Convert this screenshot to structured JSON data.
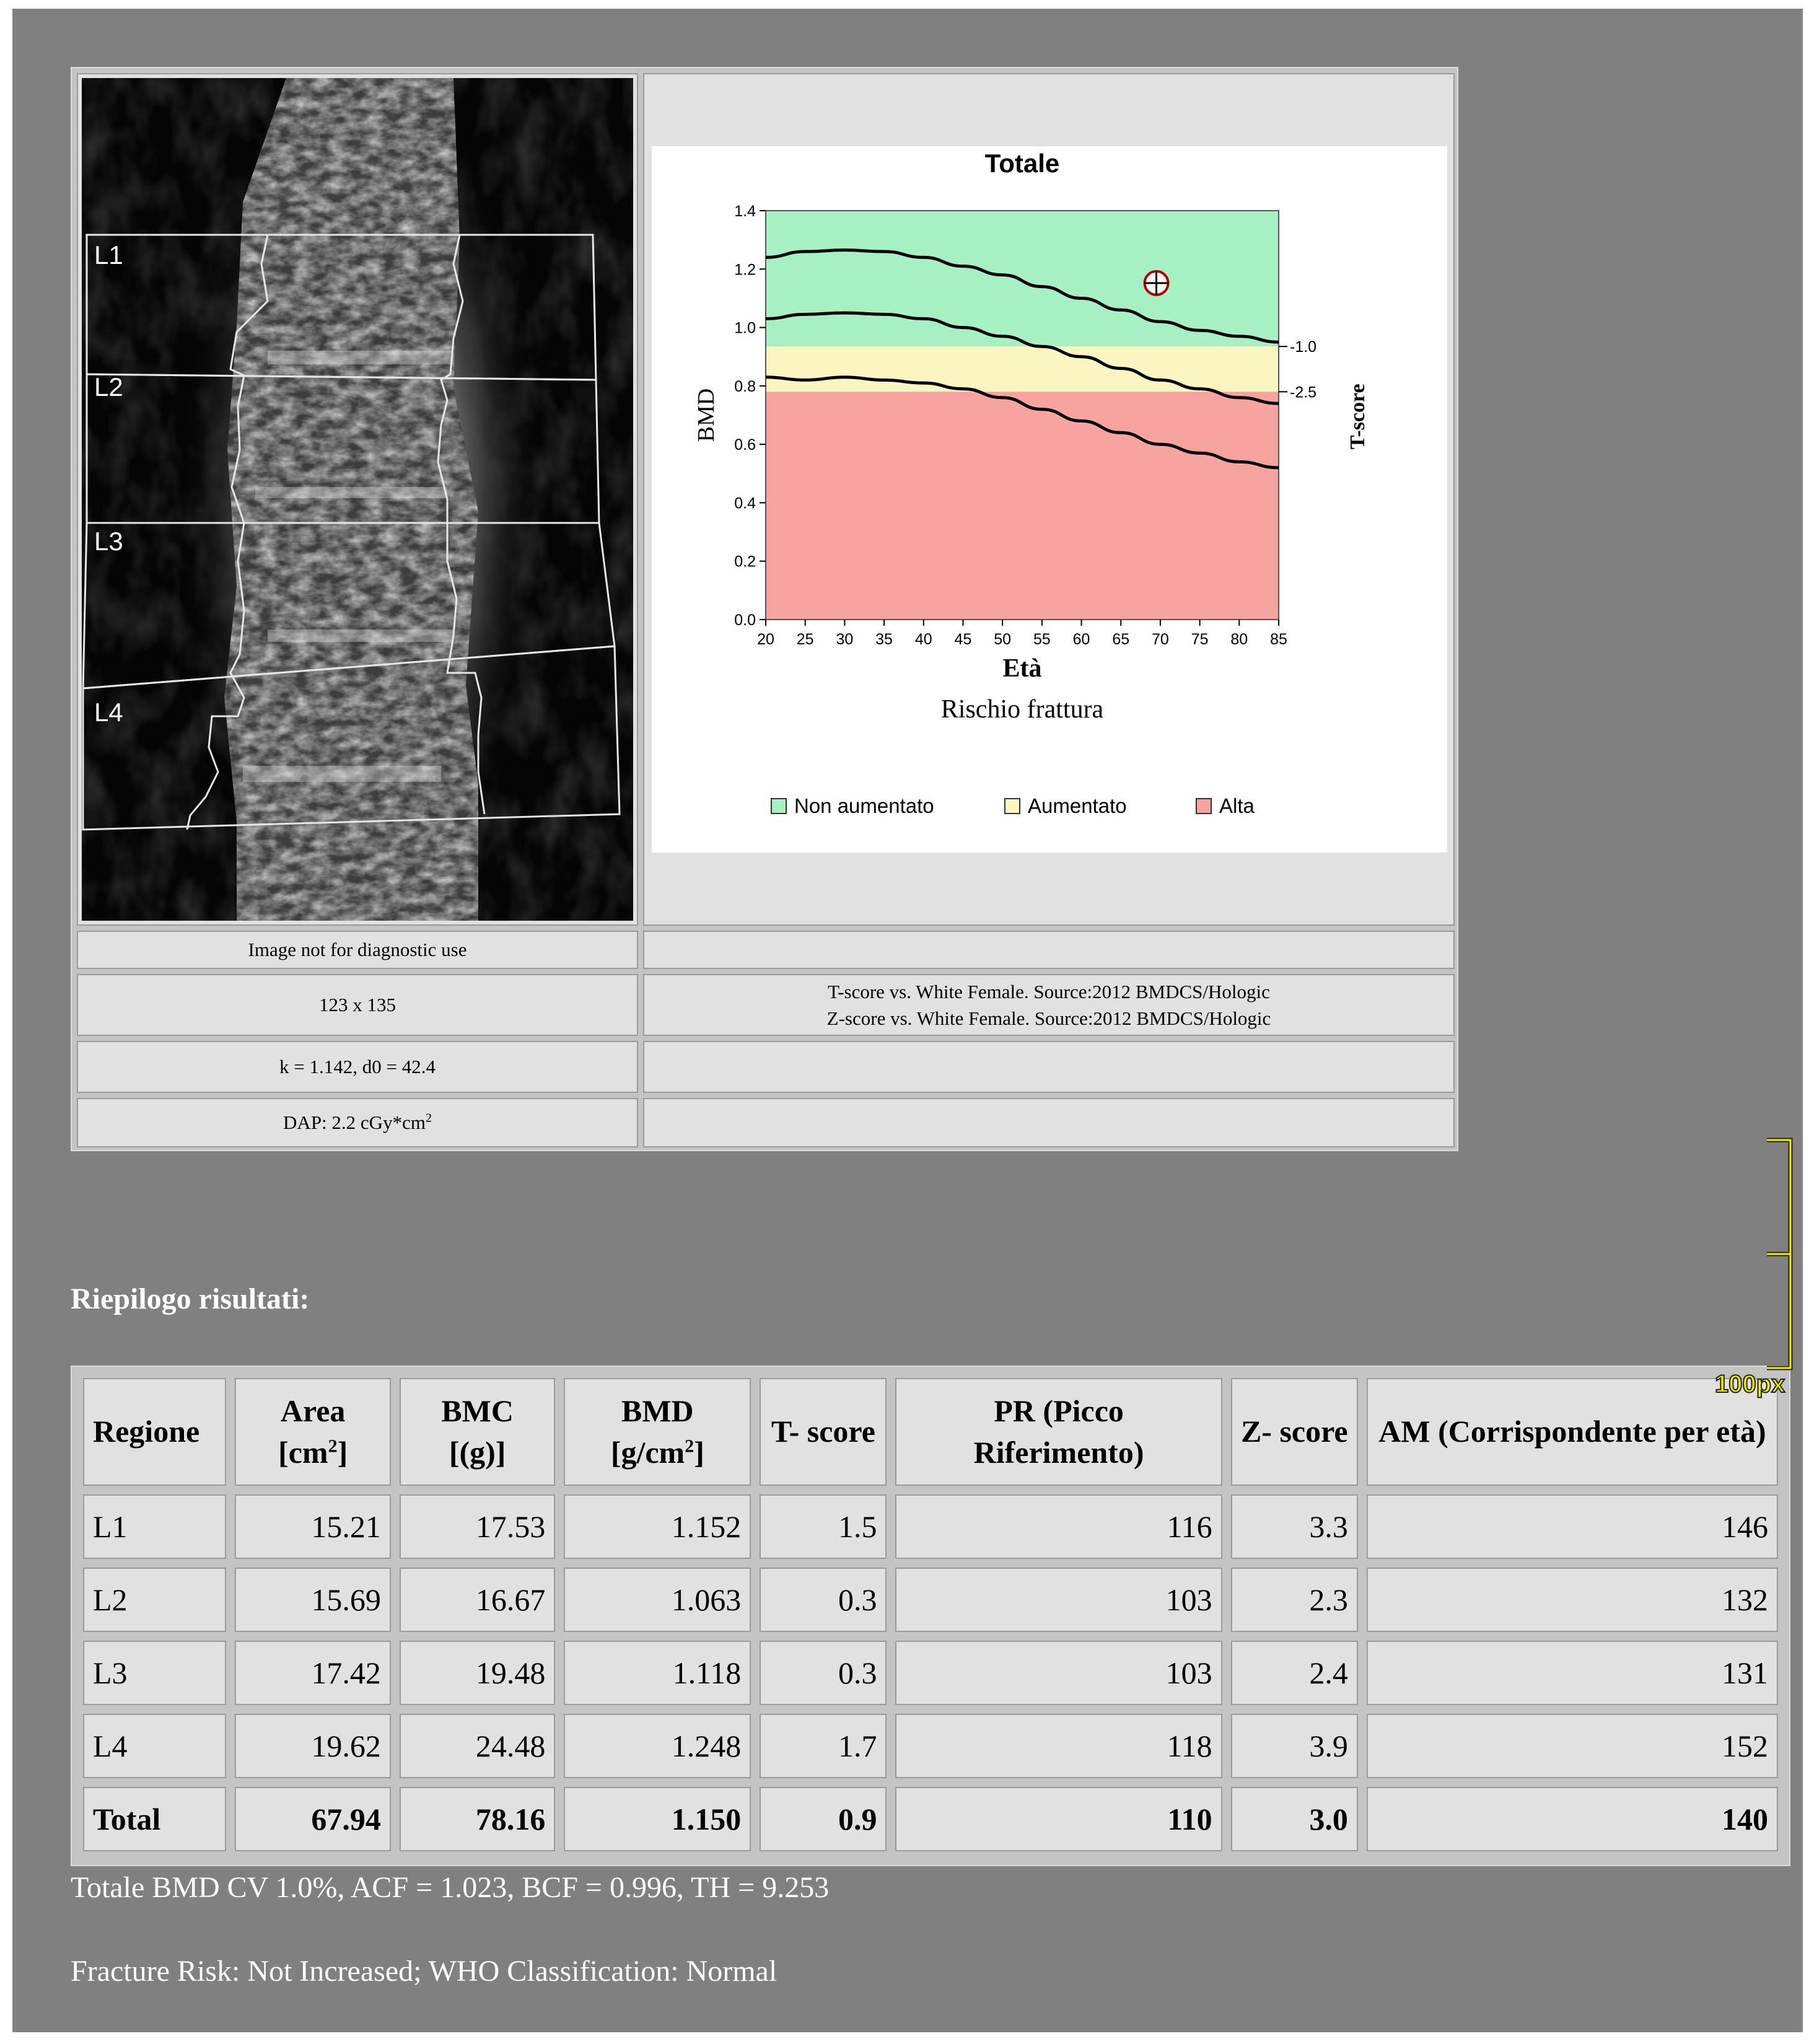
{
  "scan": {
    "regions": [
      "L1",
      "L2",
      "L3",
      "L4"
    ]
  },
  "chart_data": {
    "type": "line",
    "title": "Totale",
    "xlabel": "Età",
    "ylabel": "BMD",
    "y2label": "T-score",
    "x_ticks": [
      20,
      25,
      30,
      35,
      40,
      45,
      50,
      55,
      60,
      65,
      70,
      75,
      80,
      85
    ],
    "y_ticks": [
      "0.0",
      "0.2",
      "0.4",
      "0.6",
      "0.8",
      "1.0",
      "1.2",
      "1.4"
    ],
    "xlim": [
      20,
      85
    ],
    "ylim": [
      0.0,
      1.4
    ],
    "right_axis_ticks": [
      {
        "label": "-1.0",
        "bmd": 0.935
      },
      {
        "label": "-2.5",
        "bmd": 0.78
      }
    ],
    "zones": [
      {
        "name": "Non aumentato",
        "from": 0.935,
        "to": 1.4,
        "color": "#a6f0c4"
      },
      {
        "name": "Aumentato",
        "from": 0.78,
        "to": 0.935,
        "color": "#fbf5c1"
      },
      {
        "name": "Alta",
        "from": 0.0,
        "to": 0.78,
        "color": "#f7a3a0"
      }
    ],
    "series": [
      {
        "x": [
          20,
          25,
          30,
          35,
          40,
          45,
          50,
          55,
          60,
          65,
          70,
          75,
          80,
          85
        ],
        "y": [
          1.24,
          1.26,
          1.265,
          1.26,
          1.24,
          1.21,
          1.18,
          1.14,
          1.1,
          1.06,
          1.02,
          0.99,
          0.97,
          0.95
        ]
      },
      {
        "x": [
          20,
          25,
          30,
          35,
          40,
          45,
          50,
          55,
          60,
          65,
          70,
          75,
          80,
          85
        ],
        "y": [
          1.03,
          1.045,
          1.05,
          1.045,
          1.03,
          1.0,
          0.97,
          0.935,
          0.9,
          0.86,
          0.82,
          0.79,
          0.76,
          0.74
        ]
      },
      {
        "x": [
          20,
          25,
          30,
          35,
          40,
          45,
          50,
          55,
          60,
          65,
          70,
          75,
          80,
          85
        ],
        "y": [
          0.83,
          0.82,
          0.83,
          0.82,
          0.81,
          0.79,
          0.76,
          0.72,
          0.68,
          0.64,
          0.6,
          0.57,
          0.54,
          0.52
        ]
      }
    ],
    "patient_point": {
      "x": 69.5,
      "y": 1.152
    },
    "legend_title": "Rischio frattura",
    "legend": [
      "Non aumentato",
      "Aumentato",
      "Alta"
    ]
  },
  "info_cells": {
    "disclaimer": "Image not for diagnostic use",
    "matrix": "123 x 135",
    "reference_t": "T-score vs. White Female. Source:2012 BMDCS/Hologic",
    "reference_z": "Z-score vs. White Female. Source:2012 BMDCS/Hologic",
    "calibration": "k = 1.142, d0 = 42.4",
    "dap_text": "DAP: 2.2 cGy*cm",
    "dap_sup": "2"
  },
  "summary": {
    "title": "Riepilogo risultati:",
    "headers": [
      {
        "text": "Regione",
        "sup": "",
        "tail": ""
      },
      {
        "text": "Area [cm",
        "sup": "2",
        "tail": "]"
      },
      {
        "text": "BMC [(g)]",
        "sup": "",
        "tail": ""
      },
      {
        "text": "BMD [g/cm",
        "sup": "2",
        "tail": "]"
      },
      {
        "text": "T- score",
        "sup": "",
        "tail": ""
      },
      {
        "text": "PR (Picco Riferimento)",
        "sup": "",
        "tail": ""
      },
      {
        "text": "Z- score",
        "sup": "",
        "tail": ""
      },
      {
        "text": "AM (Corrispondente per età)",
        "sup": "",
        "tail": ""
      }
    ],
    "rows": [
      [
        "L1",
        "15.21",
        "17.53",
        "1.152",
        "1.5",
        "116",
        "3.3",
        "146"
      ],
      [
        "L2",
        "15.69",
        "16.67",
        "1.063",
        "0.3",
        "103",
        "2.3",
        "132"
      ],
      [
        "L3",
        "17.42",
        "19.48",
        "1.118",
        "0.3",
        "103",
        "2.4",
        "131"
      ],
      [
        "L4",
        "19.62",
        "24.48",
        "1.248",
        "1.7",
        "118",
        "3.9",
        "152"
      ],
      [
        "Total",
        "67.94",
        "78.16",
        "1.150",
        "0.9",
        "110",
        "3.0",
        "140"
      ]
    ],
    "footnote_1": "Totale BMD CV 1.0%, ACF = 1.023, BCF = 0.996, TH = 9.253",
    "footnote_2": "Fracture Risk: Not Increased; WHO Classification: Normal"
  },
  "overlay": {
    "ruler_label": "100px",
    "ruler_color": "#f2f200"
  }
}
